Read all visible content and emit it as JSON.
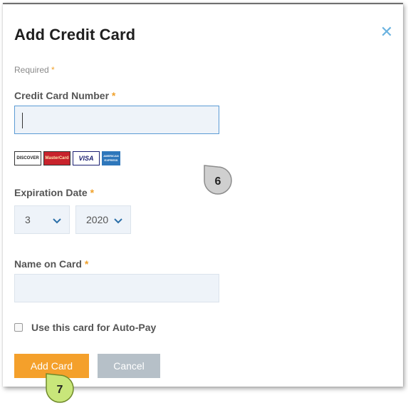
{
  "modal": {
    "title": "Add Credit Card",
    "required_note": "Required",
    "required_mark": "*",
    "close_icon": "close-icon"
  },
  "card_number": {
    "label": "Credit Card Number",
    "value": "",
    "accepted_cards": [
      "DISCOVER",
      "MasterCard",
      "VISA",
      "AMERICAN EXPRESS"
    ]
  },
  "expiration": {
    "label": "Expiration Date",
    "month": "3",
    "year": "2020"
  },
  "name_on_card": {
    "label": "Name on Card",
    "value": ""
  },
  "autopay": {
    "label": "Use this card for Auto-Pay",
    "checked": false
  },
  "buttons": {
    "add": "Add Card",
    "cancel": "Cancel"
  },
  "callouts": {
    "step6": "6",
    "step7": "7"
  },
  "colors": {
    "accent": "#f4a02b",
    "close": "#6bb3e0",
    "focus_border": "#5b9bd5",
    "callout_gray": "#cfcfcf",
    "callout_green": "#c8e67a"
  }
}
